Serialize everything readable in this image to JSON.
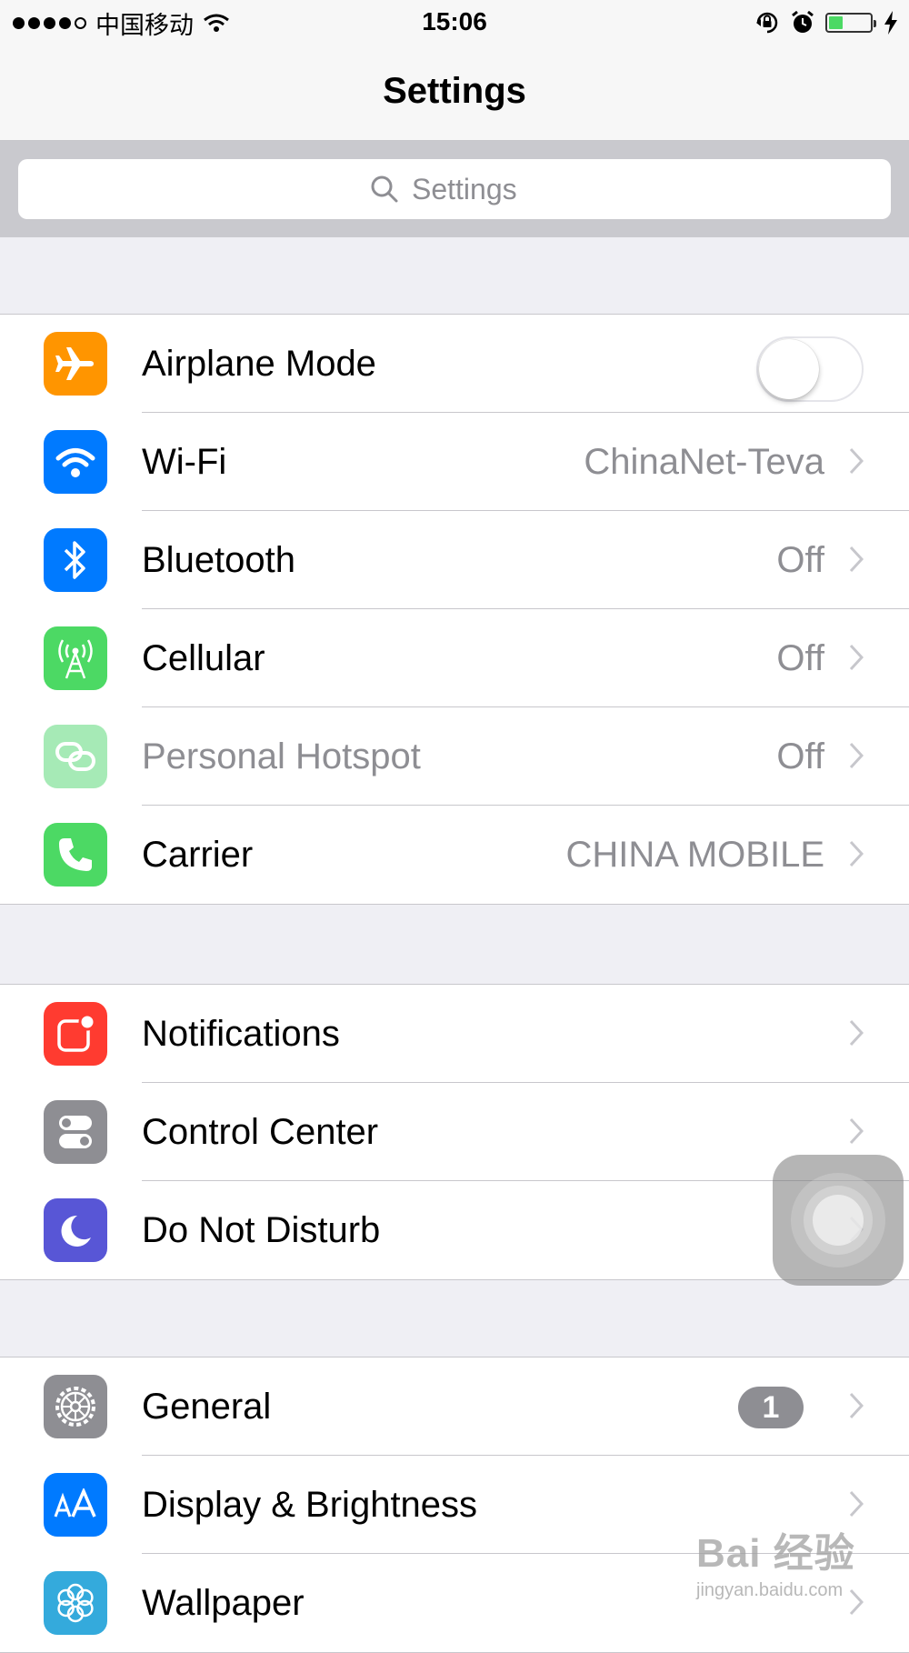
{
  "status_bar": {
    "carrier": "中国移动",
    "time": "15:06",
    "battery_level": 0.35,
    "signal_bars": 4,
    "signal_total": 5
  },
  "nav": {
    "title": "Settings"
  },
  "search": {
    "placeholder": "Settings"
  },
  "groups": [
    {
      "items": [
        {
          "label": "Airplane Mode",
          "icon": "airplane-icon",
          "icon_bg": "#ff9500",
          "control": "toggle",
          "toggle_on": false
        },
        {
          "label": "Wi-Fi",
          "icon": "wifi-icon",
          "icon_bg": "#007aff",
          "value": "ChinaNet-Teva"
        },
        {
          "label": "Bluetooth",
          "icon": "bluetooth-icon",
          "icon_bg": "#007aff",
          "value": "Off"
        },
        {
          "label": "Cellular",
          "icon": "cellular-icon",
          "icon_bg": "#4cd964",
          "value": "Off"
        },
        {
          "label": "Personal Hotspot",
          "icon": "hotspot-icon",
          "icon_bg": "#a6eab6",
          "value": "Off",
          "disabled": true
        },
        {
          "label": "Carrier",
          "icon": "phone-icon",
          "icon_bg": "#4cd964",
          "value": "CHINA MOBILE"
        }
      ]
    },
    {
      "items": [
        {
          "label": "Notifications",
          "icon": "notifications-icon",
          "icon_bg": "#ff3b30"
        },
        {
          "label": "Control Center",
          "icon": "control-center-icon",
          "icon_bg": "#8e8e93"
        },
        {
          "label": "Do Not Disturb",
          "icon": "moon-icon",
          "icon_bg": "#5856d6"
        }
      ]
    },
    {
      "items": [
        {
          "label": "General",
          "icon": "gear-icon",
          "icon_bg": "#8e8e93",
          "badge": "1"
        },
        {
          "label": "Display & Brightness",
          "icon": "display-icon",
          "icon_bg": "#007aff"
        },
        {
          "label": "Wallpaper",
          "icon": "wallpaper-icon",
          "icon_bg": "#34aadc"
        }
      ]
    }
  ],
  "watermark": {
    "logo": "Bai 经验",
    "url": "jingyan.baidu.com"
  },
  "colors": {
    "chevron": "#c7c7cc",
    "secondary_text": "#8e8e93",
    "separator": "#c8c7cc"
  }
}
